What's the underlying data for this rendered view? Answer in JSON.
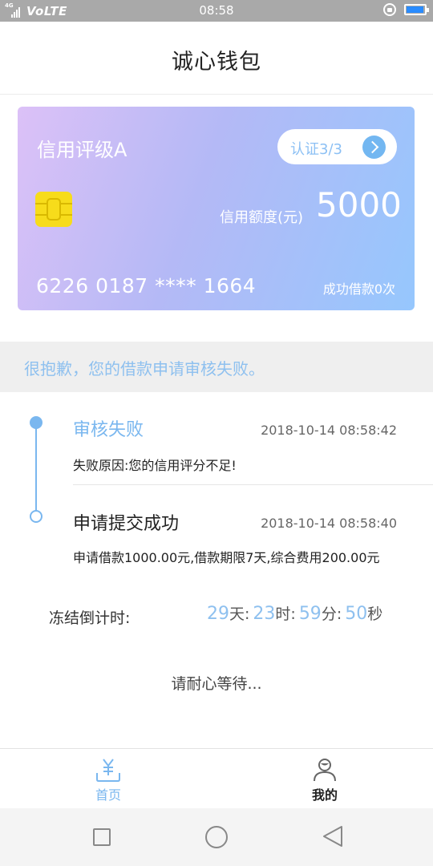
{
  "status_bar": {
    "network": "4G",
    "carrier_label": "VoLTE",
    "time": "08:58",
    "battery_level": 0.95,
    "icons": [
      "signal-icon",
      "rotation-lock-icon",
      "battery-icon"
    ]
  },
  "header": {
    "title": "诚心钱包"
  },
  "card": {
    "credit_grade": "信用评级A",
    "verify_label": "认证3/3",
    "limit_label": "信用额度(元)",
    "limit_value": "5000",
    "card_number": "6226 0187 **** 1664",
    "loan_count": "成功借款0次",
    "gradient_colors": [
      "#dcc1f7",
      "#b4b9f6",
      "#96c7fd"
    ]
  },
  "notice": {
    "text": "很抱歉，您的借款申请审核失败。"
  },
  "timeline": [
    {
      "title": "审核失败",
      "time": "2018-10-14 08:58:42",
      "desc": "失败原因:您的信用评分不足!",
      "status": "active"
    },
    {
      "title": "申请提交成功",
      "time": "2018-10-14 08:58:40",
      "desc": "申请借款1000.00元,借款期限7天,综合费用200.00元",
      "status": "done"
    }
  ],
  "countdown": {
    "label": "冻结倒计时:",
    "days": "29",
    "days_unit": "天:",
    "hours": "23",
    "hours_unit": "时:",
    "minutes": "59",
    "minutes_unit": "分:",
    "seconds": "50",
    "seconds_unit": "秒"
  },
  "wait_text": "请耐心等待...",
  "bottom_nav": {
    "home_label": "首页",
    "home_icon": "yen-tray-icon",
    "mine_label": "我的",
    "mine_icon": "user-icon",
    "active": "home"
  },
  "system_nav": {
    "icons": [
      "recent-apps-icon",
      "home-icon",
      "back-icon"
    ]
  },
  "colors": {
    "accent": "#7ab7ef",
    "status_bar": "#a9a9a9",
    "chip": "#f7dc1b"
  }
}
